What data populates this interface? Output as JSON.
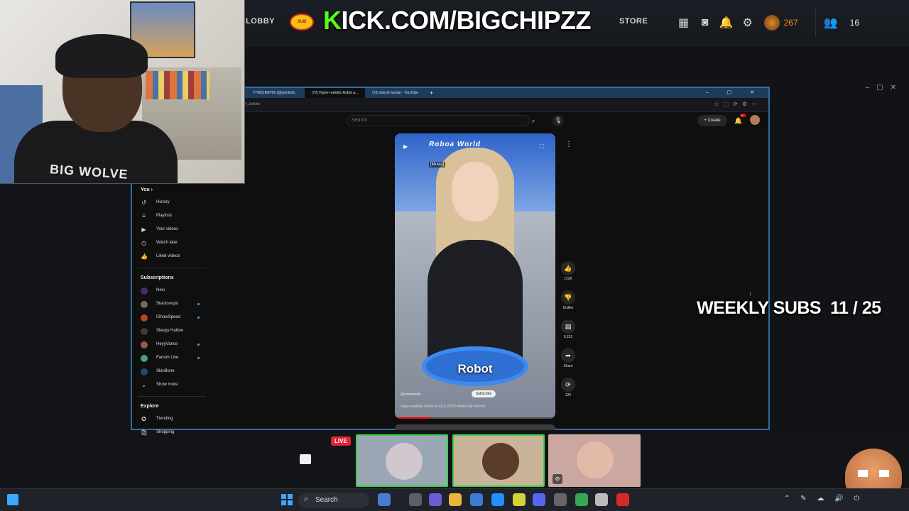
{
  "topbar": {
    "nav": [
      "LOBBY",
      "STORE"
    ],
    "banner_k": "K",
    "banner_rest": "ICK.COM/BIGCHIPZZ",
    "coin_count": "267",
    "friend_count": "16",
    "icons": [
      "grid-icon",
      "camera-icon",
      "bell-icon",
      "gear-icon"
    ]
  },
  "webcam": {
    "shirt_text": "BIG WOLVE"
  },
  "browser": {
    "tabs": [
      "TYNOLIMIT05 (@tyonlimit...",
      "(72) Hyper-realistic Robot a...",
      "(72) detroit human - YouTube"
    ],
    "tab_plus": "+",
    "address": "R_3aWdo",
    "window_controls": "– ▢ ✕"
  },
  "youtube": {
    "search_placeholder": "Search",
    "create_label": "+ Create",
    "bell_badge": "9+",
    "sidebar": {
      "you_label": "You ›",
      "you_items": [
        {
          "label": "History",
          "icon": "history-icon",
          "glyph": "↺"
        },
        {
          "label": "Playlists",
          "icon": "playlists-icon",
          "glyph": "≡"
        },
        {
          "label": "Your videos",
          "icon": "your-videos-icon",
          "glyph": "▶"
        },
        {
          "label": "Watch later",
          "icon": "watch-later-icon",
          "glyph": "◷"
        },
        {
          "label": "Liked videos",
          "icon": "thumbs-up-icon",
          "glyph": "👍"
        }
      ],
      "subscriptions_label": "Subscriptions",
      "subscriptions": [
        {
          "label": "Nexi",
          "color": "#4a2b7a",
          "live": false
        },
        {
          "label": "Stacksvopo",
          "color": "#7a6a5a",
          "live": true
        },
        {
          "label": "IShowSpeed",
          "color": "#b8442b",
          "live": true
        },
        {
          "label": "Sleepy Hallow",
          "color": "#3a3a3a",
          "live": false
        },
        {
          "label": "HeyyVance",
          "color": "#9a5a4a",
          "live": true
        },
        {
          "label": "Fanum Live",
          "color": "#4aa07a",
          "live": true
        },
        {
          "label": "SkinBone",
          "color": "#2a4a6a",
          "live": false
        }
      ],
      "show_more": "Show more",
      "explore_label": "Explore",
      "explore_items": [
        {
          "label": "Trending",
          "icon": "trending-icon",
          "glyph": "✪"
        },
        {
          "label": "Shopping",
          "icon": "shopping-icon",
          "glyph": "🛍"
        }
      ]
    },
    "short": {
      "booth_text": "Roboa World",
      "music_tag": "[Music]",
      "caption": "Robot",
      "channel": "@robotworld...",
      "subscribe": "Subscribe",
      "description": "Hyper-realistic Robot at CES 2025! #robot #ai #shorts",
      "progress": 0.22
    },
    "actions": [
      {
        "name": "like-button",
        "icon": "thumbs-up-icon",
        "glyph": "👍",
        "label": "132K"
      },
      {
        "name": "dislike-button",
        "icon": "thumbs-down-icon",
        "glyph": "👎",
        "label": "Dislike"
      },
      {
        "name": "comments-button",
        "icon": "comment-icon",
        "glyph": "▤",
        "label": "9,232"
      },
      {
        "name": "share-button",
        "icon": "share-icon",
        "glyph": "➦",
        "label": "Share"
      },
      {
        "name": "remix-button",
        "icon": "remix-icon",
        "glyph": "⟳",
        "label": "126"
      }
    ]
  },
  "overlay": {
    "weekly_subs_label": "WEEKLY SUBS",
    "weekly_subs_value": "11 / 25",
    "live_badge": "LIVE"
  },
  "taskbar": {
    "search_label": "Search"
  },
  "colors": {
    "accent": "#3ea6ff",
    "kick_green": "#53fc18",
    "live_red": "#e0243a"
  }
}
